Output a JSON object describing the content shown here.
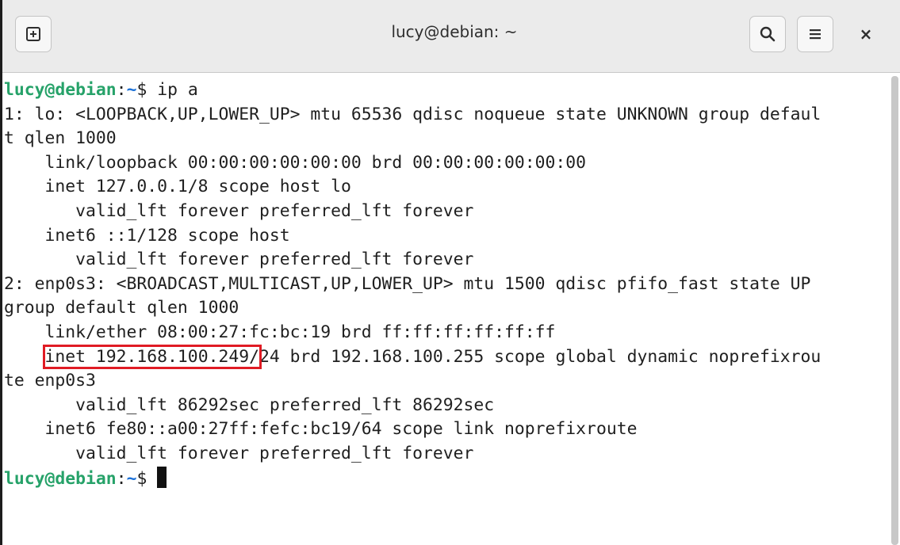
{
  "window": {
    "title": "lucy@debian: ~"
  },
  "headerbar": {
    "newtab_icon": "new-tab-icon",
    "search_icon": "search-icon",
    "menu_icon": "hamburger-menu-icon",
    "close_label": "×"
  },
  "prompt": {
    "user_host": "lucy@debian",
    "sep": ":",
    "path": "~",
    "symbol": "$ "
  },
  "command": "ip a",
  "output": [
    "1: lo: <LOOPBACK,UP,LOWER_UP> mtu 65536 qdisc noqueue state UNKNOWN group defaul",
    "t qlen 1000",
    "    link/loopback 00:00:00:00:00:00 brd 00:00:00:00:00:00",
    "    inet 127.0.0.1/8 scope host lo",
    "       valid_lft forever preferred_lft forever",
    "    inet6 ::1/128 scope host",
    "       valid_lft forever preferred_lft forever",
    "2: enp0s3: <BROADCAST,MULTICAST,UP,LOWER_UP> mtu 1500 qdisc pfifo_fast state UP",
    "group default qlen 1000",
    "    link/ether 08:00:27:fc:bc:19 brd ff:ff:ff:ff:ff:ff"
  ],
  "highlight_line": {
    "indent": "    ",
    "highlighted": "inet 192.168.100.249/",
    "rest": "24 brd 192.168.100.255 scope global dynamic noprefixrou"
  },
  "output_after": [
    "te enp0s3",
    "       valid_lft 86292sec preferred_lft 86292sec",
    "    inet6 fe80::a00:27ff:fefc:bc19/64 scope link noprefixroute",
    "       valid_lft forever preferred_lft forever"
  ],
  "colors": {
    "prompt_user": "#26a269",
    "prompt_path": "#1c71d8",
    "highlight_box": "#e01b24"
  }
}
